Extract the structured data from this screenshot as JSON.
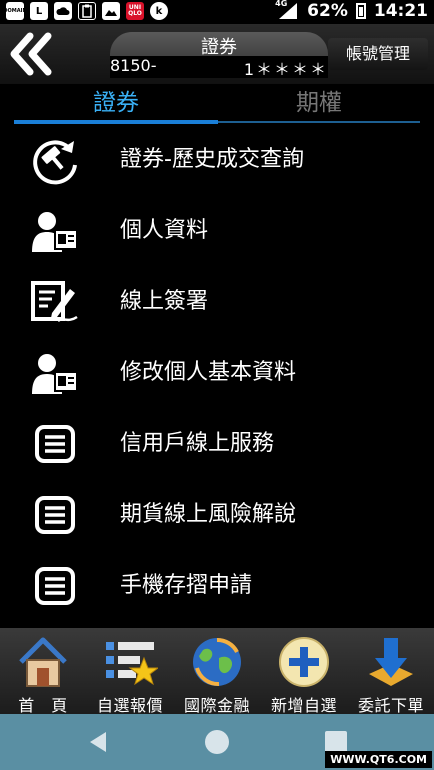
{
  "status_bar": {
    "left_icons": [
      {
        "icon": "domain-mascot-icon",
        "text": "DOMAIN"
      },
      {
        "icon": "letter-l-icon",
        "text": "L"
      },
      {
        "icon": "weather-icon",
        "text": ""
      },
      {
        "icon": "clipboard-icon",
        "text": ""
      },
      {
        "icon": "image-icon",
        "text": ""
      },
      {
        "icon": "uniqlo-icon",
        "text": "UNI QLO"
      },
      {
        "icon": "k-app-icon",
        "text": "k"
      }
    ],
    "network": "4G",
    "battery": "62%",
    "time": "14:21"
  },
  "header": {
    "back_icon": "double-chevron-left-icon",
    "account_title": "證券",
    "account_prefix": "8150-",
    "account_suffix": "1＊＊＊＊",
    "account_manage_label": "帳號管理"
  },
  "tabs": [
    {
      "label": "證券",
      "active": true
    },
    {
      "label": "期權",
      "active": false
    }
  ],
  "menu": [
    {
      "label": "證券-歷史成交查詢",
      "icon": "history-gavel-icon"
    },
    {
      "label": "個人資料",
      "icon": "person-card-icon"
    },
    {
      "label": "線上簽署",
      "icon": "sign-document-icon"
    },
    {
      "label": "修改個人基本資料",
      "icon": "person-card-icon"
    },
    {
      "label": "信用戶線上服務",
      "icon": "document-list-icon"
    },
    {
      "label": "期貨線上風險解說",
      "icon": "document-list-icon"
    },
    {
      "label": "手機存摺申請",
      "icon": "document-list-icon"
    }
  ],
  "toolbar": [
    {
      "label": "首　頁",
      "icon": "home-icon"
    },
    {
      "label": "自選報價",
      "icon": "watchlist-star-icon"
    },
    {
      "label": "國際金融",
      "icon": "globe-icon"
    },
    {
      "label": "新增自選",
      "icon": "add-circle-icon"
    },
    {
      "label": "委託下單",
      "icon": "download-arrow-icon"
    }
  ],
  "nav_bar": {
    "back_icon": "triangle-back-icon",
    "home_icon": "circle-home-icon",
    "recents_icon": "square-recents-icon",
    "watermark": "WWW.QT6.COM"
  },
  "colors": {
    "accent_blue": "#3ab0f5",
    "tab_underline": "#1a7fd8",
    "nav_bar": "#5a8fa3"
  }
}
